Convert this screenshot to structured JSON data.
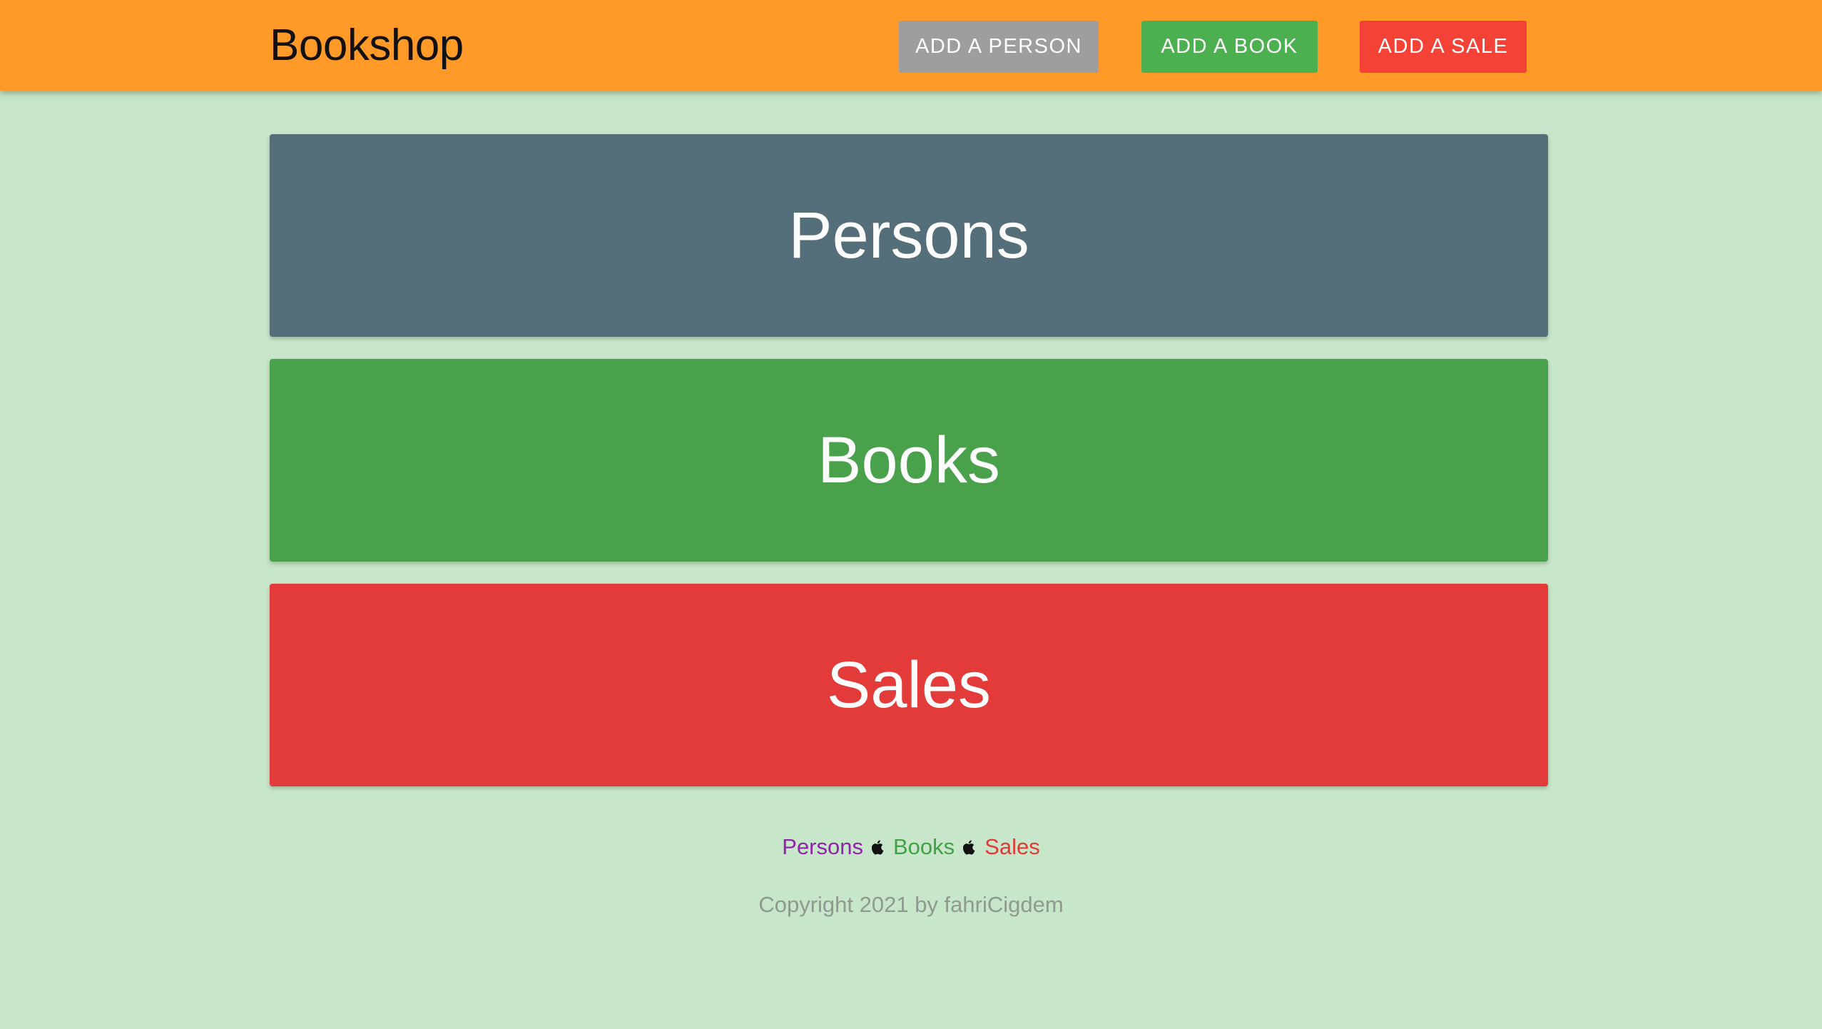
{
  "header": {
    "brand": "Bookshop",
    "buttons": {
      "add_person": "ADD A PERSON",
      "add_book": "ADD A BOOK",
      "add_sale": "ADD A SALE"
    }
  },
  "main": {
    "cards": {
      "persons": "Persons",
      "books": "Books",
      "sales": "Sales"
    }
  },
  "footer": {
    "links": {
      "persons": "Persons",
      "books": "Books",
      "sales": "Sales"
    },
    "separator_icon": "apple-icon",
    "copyright": "Copyright 2021 by fahriCigdem"
  },
  "colors": {
    "header_bg": "#ff9a28",
    "page_bg": "#c8e6c9",
    "persons": "#546e7a",
    "books": "#4aa14c",
    "sales": "#e33a3a",
    "add_person_button": "#9e9e9e",
    "add_book_button": "#4caf50",
    "add_sale_button": "#f44336"
  }
}
